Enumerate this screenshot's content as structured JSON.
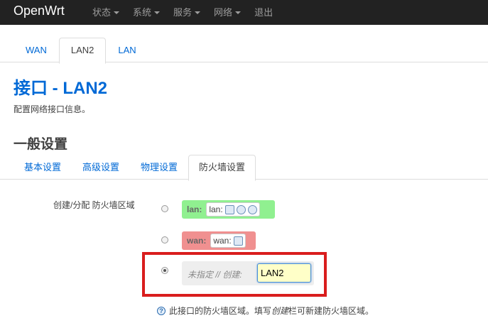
{
  "brand": "OpenWrt",
  "menu": [
    {
      "label": "状态",
      "has_caret": true
    },
    {
      "label": "系统",
      "has_caret": true
    },
    {
      "label": "服务",
      "has_caret": true
    },
    {
      "label": "网络",
      "has_caret": true
    },
    {
      "label": "退出",
      "has_caret": false
    }
  ],
  "interface_tabs": [
    "WAN",
    "LAN2",
    "LAN"
  ],
  "interface_tab_active": "LAN2",
  "page_title": "接口 - LAN2",
  "page_description": "配置网络接口信息。",
  "section_title": "一般设置",
  "sub_tabs": [
    "基本设置",
    "高级设置",
    "物理设置",
    "防火墙设置"
  ],
  "sub_tab_active": "防火墙设置",
  "firewall": {
    "label": "创建/分配 防火墙区域",
    "zones": [
      {
        "name": "lan:",
        "members": "lan:",
        "color": "#90f090",
        "selected": false,
        "icons": [
          "network-icon",
          "wifi-icon",
          "wifi-icon"
        ]
      },
      {
        "name": "wan:",
        "members": "wan:",
        "color": "#f09090",
        "selected": false,
        "icons": [
          "ethernet-icon"
        ]
      }
    ],
    "new_zone": {
      "label": "未指定 // 创建:",
      "value": "LAN2",
      "selected": true
    },
    "hint_before": "此接口的防火墙区域。填写",
    "hint_em": "创建",
    "hint_after": "栏可新建防火墙区域。"
  }
}
